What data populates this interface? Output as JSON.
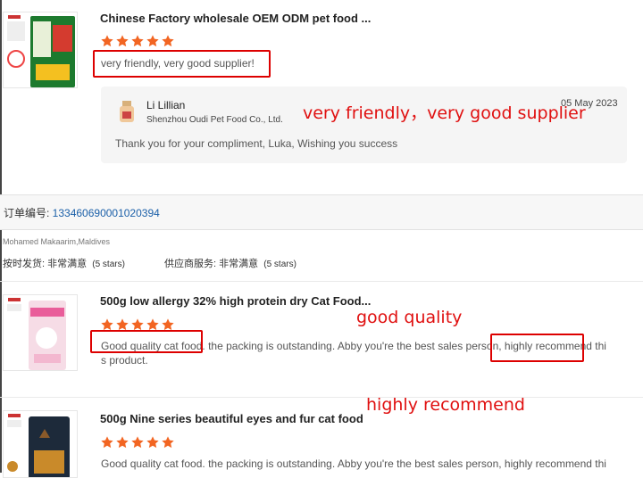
{
  "item1": {
    "title": "Chinese Factory wholesale OEM ODM pet food ...",
    "rating": 5,
    "review": "very friendly, very good supplier!",
    "reply": {
      "name": "Li Lillian",
      "company": "Shenzhou Oudi Pet Food Co., Ltd.",
      "date": "05 May 2023",
      "message": "Thank you for your compliment, Luka,  Wishing you success"
    },
    "annotation": "very friendly，very good supplier"
  },
  "order": {
    "label": "订单编号: ",
    "number": "133460690001020394"
  },
  "buyer": {
    "name": "Mohamed Makaarim,Maldives",
    "ratings": [
      {
        "label": "按时发货:",
        "value": "非常满意",
        "stars": "(5 stars)"
      },
      {
        "label": "供应商服务:",
        "value": "非常满意",
        "stars": "(5 stars)"
      }
    ]
  },
  "item2": {
    "title": "500g low allergy 32% high protein dry Cat Food...",
    "rating": 5,
    "review_line1": "Good quality cat food. the packing is outstanding. Abby you're the best sales person, highly recommend thi",
    "review_line2": "s product.",
    "annotation_a": "good quality",
    "annotation_b": "highly recommend"
  },
  "item3": {
    "title": "500g Nine series beautiful eyes and fur cat food",
    "rating": 5,
    "review_line1": "Good quality cat food. the packing is outstanding. Abby you're the best sales person, highly recommend thi"
  },
  "colors": {
    "star": "#f26522",
    "annotation": "#e01010",
    "order_link": "#1a5fa8",
    "divider": "#eaeaea"
  }
}
